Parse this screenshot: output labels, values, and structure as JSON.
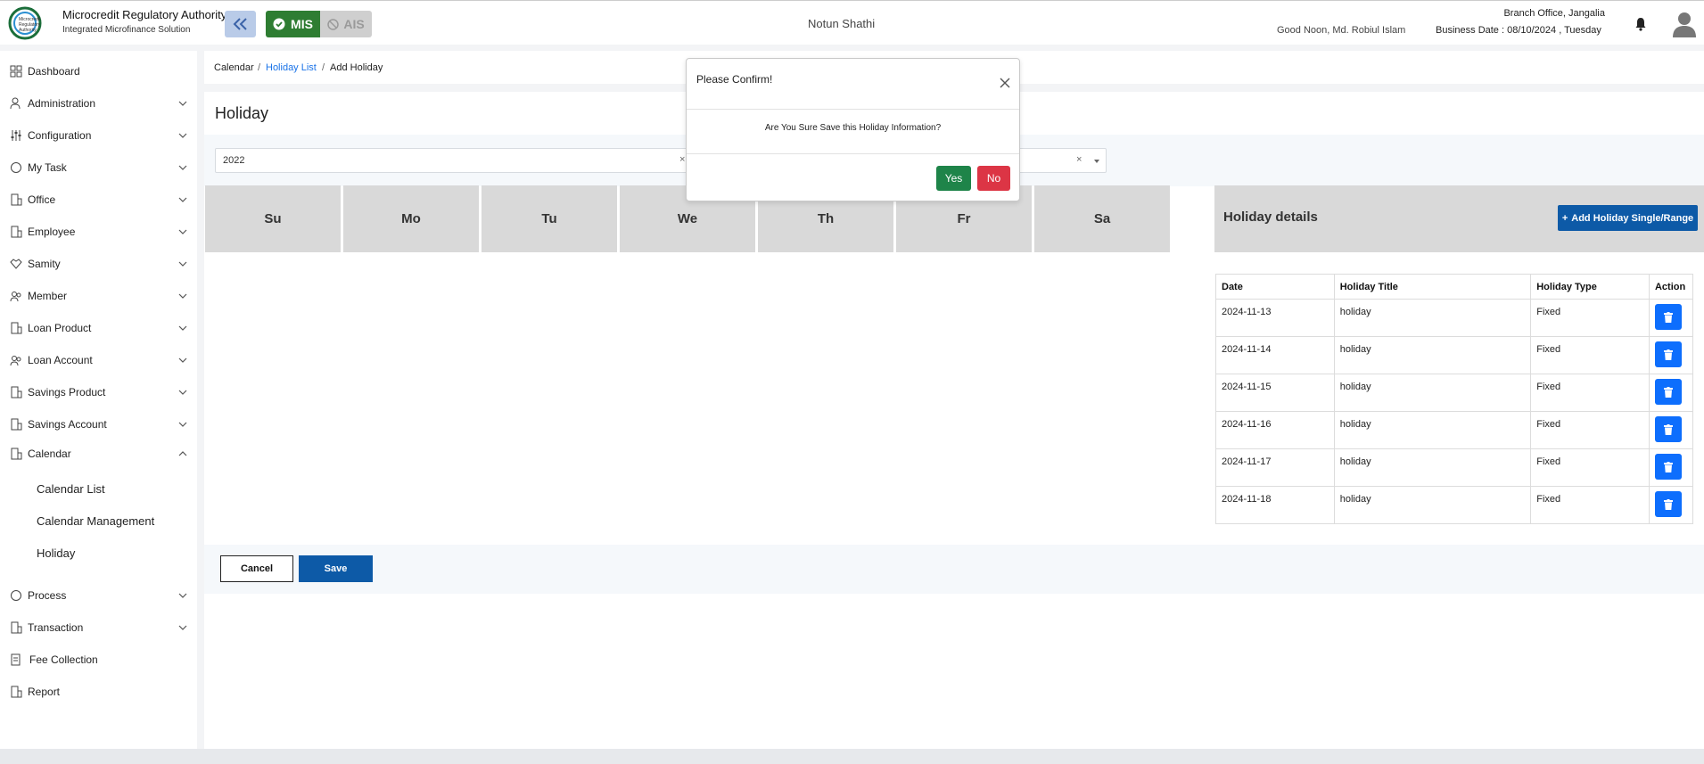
{
  "header": {
    "brand_title": "Microcredit Regulatory Authority",
    "brand_subtitle": "Integrated Microfinance Solution",
    "logo_text": [
      "Microcredit",
      "Regulatory",
      "Authority"
    ],
    "mis_label": "MIS",
    "ais_label": "AIS",
    "org_name": "Notun Shathi",
    "greeting": "Good Noon, Md. Robiul Islam",
    "branch": "Branch Office, Jangalia",
    "business_date": "Business Date : 08/10/2024 , Tuesday"
  },
  "sidebar": {
    "items": [
      {
        "label": "Dashboard",
        "icon": "dashboard-icon"
      },
      {
        "label": "Administration",
        "icon": "admin-icon"
      },
      {
        "label": "Configuration",
        "icon": "sliders-icon"
      },
      {
        "label": "My Task",
        "icon": "task-icon"
      },
      {
        "label": "Office",
        "icon": "office-icon"
      },
      {
        "label": "Employee",
        "icon": "employee-icon"
      },
      {
        "label": "Samity",
        "icon": "samity-icon"
      },
      {
        "label": "Member",
        "icon": "member-icon"
      },
      {
        "label": "Loan Product",
        "icon": "loan-product-icon"
      },
      {
        "label": "Loan Account",
        "icon": "loan-account-icon"
      },
      {
        "label": "Savings Product",
        "icon": "savings-product-icon"
      },
      {
        "label": "Savings Account",
        "icon": "savings-account-icon"
      },
      {
        "label": "Calendar",
        "icon": "calendar-icon"
      },
      {
        "label": "Process",
        "icon": "process-icon"
      },
      {
        "label": "Transaction",
        "icon": "transaction-icon"
      },
      {
        "label": "Fee Collection",
        "icon": "fee-icon"
      },
      {
        "label": "Report",
        "icon": "report-icon"
      }
    ],
    "calendar_sub": [
      "Calendar List",
      "Calendar Management",
      "Holiday"
    ]
  },
  "breadcrumb": {
    "root": "Calendar",
    "sep": "/",
    "link": "Holiday List",
    "current": "Add Holiday"
  },
  "page": {
    "title": "Holiday"
  },
  "filters": {
    "year": "2022"
  },
  "calendar": {
    "days": [
      "Su",
      "Mo",
      "Tu",
      "We",
      "Th",
      "Fr",
      "Sa"
    ]
  },
  "holiday_details": {
    "title": "Holiday details",
    "add_button": "Add Holiday Single/Range",
    "columns": [
      "Date",
      "Holiday Title",
      "Holiday Type",
      "Action"
    ],
    "rows": [
      {
        "date": "2024-11-13",
        "title": "holiday",
        "type": "Fixed"
      },
      {
        "date": "2024-11-14",
        "title": "holiday",
        "type": "Fixed"
      },
      {
        "date": "2024-11-15",
        "title": "holiday",
        "type": "Fixed"
      },
      {
        "date": "2024-11-16",
        "title": "holiday",
        "type": "Fixed"
      },
      {
        "date": "2024-11-17",
        "title": "holiday",
        "type": "Fixed"
      },
      {
        "date": "2024-11-18",
        "title": "holiday",
        "type": "Fixed"
      }
    ]
  },
  "actions": {
    "cancel": "Cancel",
    "save": "Save"
  },
  "modal": {
    "title": "Please Confirm!",
    "message": "Are You Sure Save this Holiday Information?",
    "yes": "Yes",
    "no": "No"
  },
  "colors": {
    "primary": "#0d5aa7",
    "success": "#1e8449",
    "danger": "#dc3545",
    "mis_green": "#2e7d32"
  }
}
